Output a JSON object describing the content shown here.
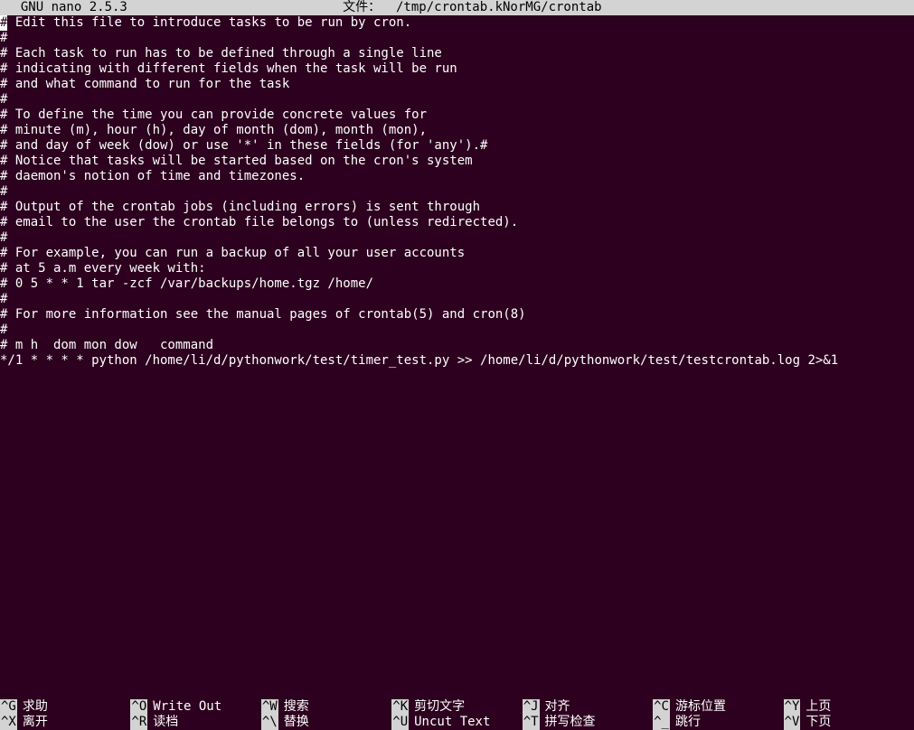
{
  "title_bar": {
    "app_name": "  GNU nano 2.5.3",
    "file_label": "文件：",
    "file_path": "/tmp/crontab.kNorMG/crontab"
  },
  "file_lines": [
    "# Edit this file to introduce tasks to be run by cron.",
    "#",
    "# Each task to run has to be defined through a single line",
    "# indicating with different fields when the task will be run",
    "# and what command to run for the task",
    "#",
    "# To define the time you can provide concrete values for",
    "# minute (m), hour (h), day of month (dom), month (mon),",
    "# and day of week (dow) or use '*' in these fields (for 'any').#",
    "# Notice that tasks will be started based on the cron's system",
    "# daemon's notion of time and timezones.",
    "#",
    "# Output of the crontab jobs (including errors) is sent through",
    "# email to the user the crontab file belongs to (unless redirected).",
    "#",
    "# For example, you can run a backup of all your user accounts",
    "# at 5 a.m every week with:",
    "# 0 5 * * 1 tar -zcf /var/backups/home.tgz /home/",
    "#",
    "# For more information see the manual pages of crontab(5) and cron(8)",
    "#",
    "# m h  dom mon dow   command",
    "*/1 * * * * python /home/li/d/pythonwork/test/timer_test.py >> /home/li/d/pythonwork/test/testcrontab.log 2>&1"
  ],
  "cursor_line": 0,
  "cursor_col": 0,
  "shortcuts": {
    "row1": [
      {
        "key": "^G",
        "label": "求助"
      },
      {
        "key": "^O",
        "label": "Write Out"
      },
      {
        "key": "^W",
        "label": "搜索"
      },
      {
        "key": "^K",
        "label": "剪切文字"
      },
      {
        "key": "^J",
        "label": "对齐"
      },
      {
        "key": "^C",
        "label": "游标位置"
      },
      {
        "key": "^Y",
        "label": "上页"
      }
    ],
    "row2": [
      {
        "key": "^X",
        "label": "离开"
      },
      {
        "key": "^R",
        "label": "读档"
      },
      {
        "key": "^\\",
        "label": "替换"
      },
      {
        "key": "^U",
        "label": "Uncut Text"
      },
      {
        "key": "^T",
        "label": "拼写检查"
      },
      {
        "key": "^_",
        "label": "跳行"
      },
      {
        "key": "^V",
        "label": "下页"
      }
    ]
  }
}
